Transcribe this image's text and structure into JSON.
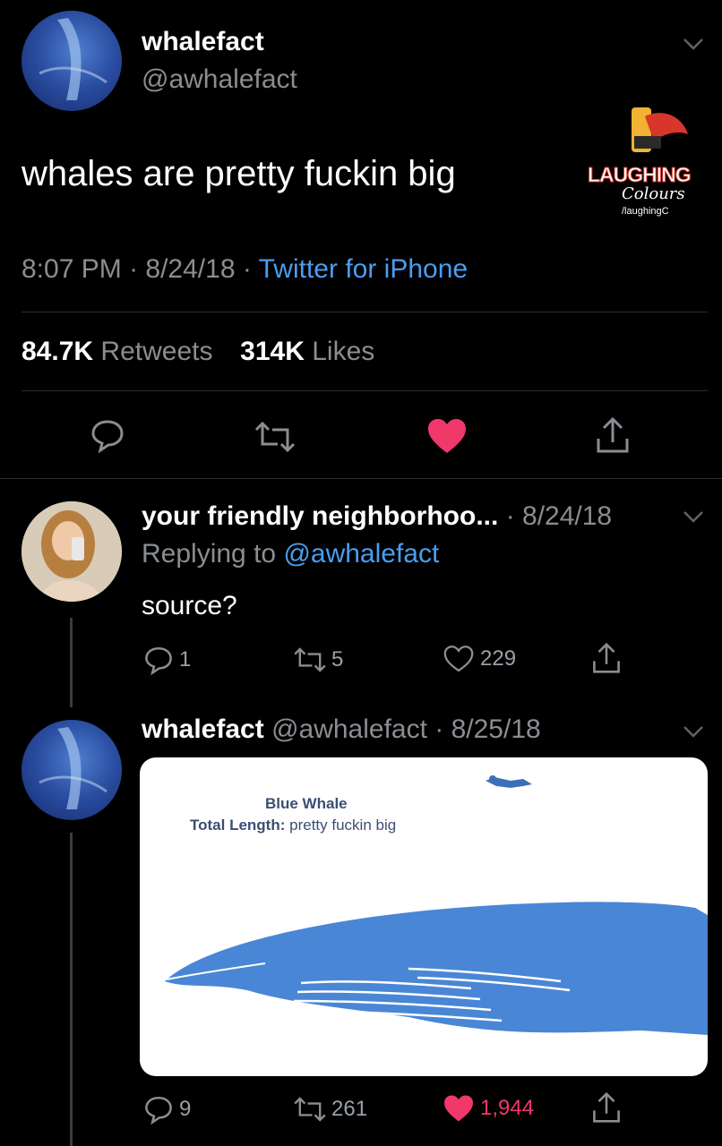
{
  "main_tweet": {
    "display_name": "whalefact",
    "handle": "@awhalefact",
    "text": "whales are pretty fuckin big",
    "time": "8:07 PM",
    "date": "8/24/18",
    "source": "Twitter for iPhone",
    "retweet_count": "84.7K",
    "retweet_label": "Retweets",
    "like_count": "314K",
    "like_label": "Likes"
  },
  "watermark": {
    "line1": "LAUGHING",
    "line2": "Colours",
    "line3": "/laughingC"
  },
  "reply1": {
    "display_name": "your friendly neighborhoo...",
    "date": "· 8/24/18",
    "replying_prefix": "Replying to",
    "replying_handle": "@awhalefact",
    "text": "source?",
    "reply_count": "1",
    "retweet_count": "5",
    "like_count": "229"
  },
  "reply2": {
    "display_name": "whalefact",
    "handle_date": "@awhalefact · 8/25/18",
    "image_title": "Blue Whale",
    "image_length_label": "Total Length:",
    "image_length_value": "pretty fuckin big",
    "reply_count": "9",
    "retweet_count": "261",
    "like_count": "1,944"
  },
  "colors": {
    "background": "#000000",
    "link": "#4a9ef0",
    "like_red": "#f1386a",
    "whale_blue": "#4a86d6"
  }
}
